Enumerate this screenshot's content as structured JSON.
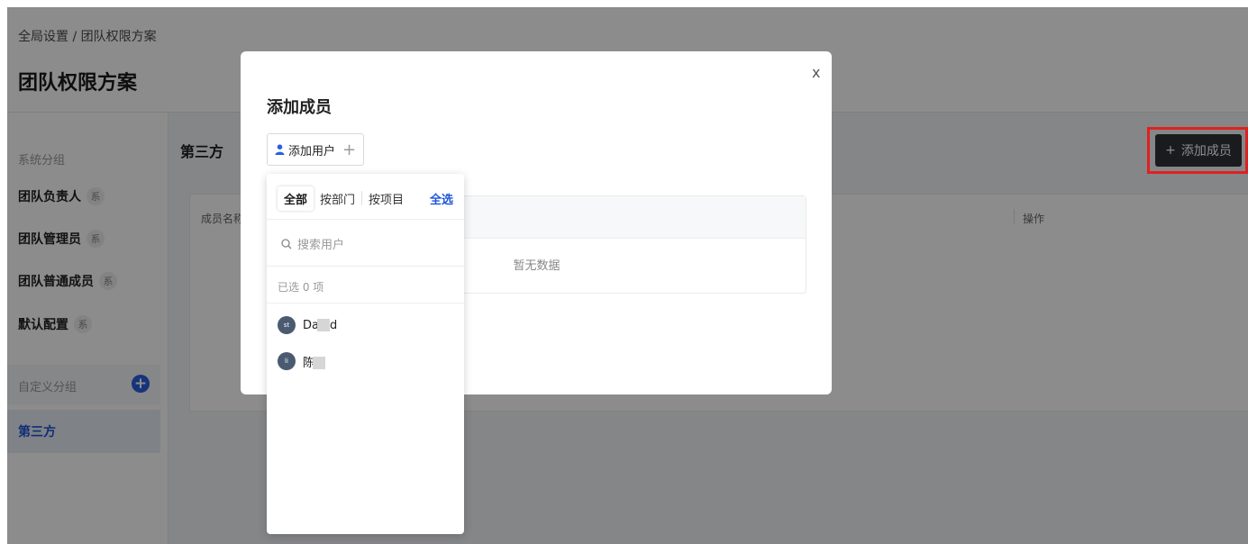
{
  "breadcrumb": "全局设置 / 团队权限方案",
  "page_title": "团队权限方案",
  "sidebar": {
    "system_group_title": "系统分组",
    "system_tag": "系",
    "items": [
      {
        "label": "团队负责人"
      },
      {
        "label": "团队管理员"
      },
      {
        "label": "团队普通成员"
      },
      {
        "label": "默认配置"
      }
    ],
    "custom_group_title": "自定义分组",
    "add_icon": "+",
    "selected_item": "第三方"
  },
  "main": {
    "title": "第三方",
    "add_member_label": "添加成员",
    "add_member_icon": "+",
    "table_columns": [
      "成员名称",
      "操作"
    ]
  },
  "modal": {
    "close": "x",
    "title": "添加成员",
    "add_user_label": "添加用户",
    "add_user_plus": "+",
    "empty_text": "暂无数据"
  },
  "dropdown": {
    "tabs": [
      "全部",
      "按部门",
      "按项目"
    ],
    "active_tab": "全部",
    "select_all": "全选",
    "search_placeholder": "搜索用户",
    "selected_count": "已选 0 项",
    "users": [
      {
        "avatar": "st",
        "name": "Da",
        "name_tail": "d"
      },
      {
        "avatar": "li",
        "name": "陈",
        "name_tail": ""
      }
    ]
  },
  "colors": {
    "accent": "#1d54d8",
    "dark_button": "#2e3238",
    "highlight": "#e02020"
  }
}
